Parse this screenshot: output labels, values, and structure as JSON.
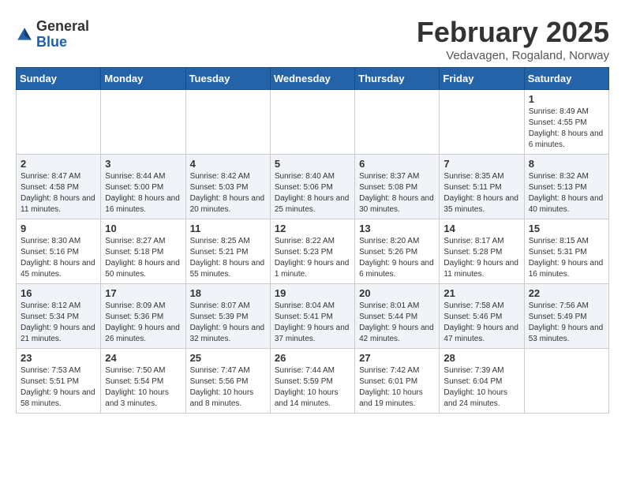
{
  "logo": {
    "general": "General",
    "blue": "Blue"
  },
  "header": {
    "title": "February 2025",
    "subtitle": "Vedavagen, Rogaland, Norway"
  },
  "weekdays": [
    "Sunday",
    "Monday",
    "Tuesday",
    "Wednesday",
    "Thursday",
    "Friday",
    "Saturday"
  ],
  "weeks": [
    [
      {
        "day": "",
        "info": ""
      },
      {
        "day": "",
        "info": ""
      },
      {
        "day": "",
        "info": ""
      },
      {
        "day": "",
        "info": ""
      },
      {
        "day": "",
        "info": ""
      },
      {
        "day": "",
        "info": ""
      },
      {
        "day": "1",
        "info": "Sunrise: 8:49 AM\nSunset: 4:55 PM\nDaylight: 8 hours and 6 minutes."
      }
    ],
    [
      {
        "day": "2",
        "info": "Sunrise: 8:47 AM\nSunset: 4:58 PM\nDaylight: 8 hours and 11 minutes."
      },
      {
        "day": "3",
        "info": "Sunrise: 8:44 AM\nSunset: 5:00 PM\nDaylight: 8 hours and 16 minutes."
      },
      {
        "day": "4",
        "info": "Sunrise: 8:42 AM\nSunset: 5:03 PM\nDaylight: 8 hours and 20 minutes."
      },
      {
        "day": "5",
        "info": "Sunrise: 8:40 AM\nSunset: 5:06 PM\nDaylight: 8 hours and 25 minutes."
      },
      {
        "day": "6",
        "info": "Sunrise: 8:37 AM\nSunset: 5:08 PM\nDaylight: 8 hours and 30 minutes."
      },
      {
        "day": "7",
        "info": "Sunrise: 8:35 AM\nSunset: 5:11 PM\nDaylight: 8 hours and 35 minutes."
      },
      {
        "day": "8",
        "info": "Sunrise: 8:32 AM\nSunset: 5:13 PM\nDaylight: 8 hours and 40 minutes."
      }
    ],
    [
      {
        "day": "9",
        "info": "Sunrise: 8:30 AM\nSunset: 5:16 PM\nDaylight: 8 hours and 45 minutes."
      },
      {
        "day": "10",
        "info": "Sunrise: 8:27 AM\nSunset: 5:18 PM\nDaylight: 8 hours and 50 minutes."
      },
      {
        "day": "11",
        "info": "Sunrise: 8:25 AM\nSunset: 5:21 PM\nDaylight: 8 hours and 55 minutes."
      },
      {
        "day": "12",
        "info": "Sunrise: 8:22 AM\nSunset: 5:23 PM\nDaylight: 9 hours and 1 minute."
      },
      {
        "day": "13",
        "info": "Sunrise: 8:20 AM\nSunset: 5:26 PM\nDaylight: 9 hours and 6 minutes."
      },
      {
        "day": "14",
        "info": "Sunrise: 8:17 AM\nSunset: 5:28 PM\nDaylight: 9 hours and 11 minutes."
      },
      {
        "day": "15",
        "info": "Sunrise: 8:15 AM\nSunset: 5:31 PM\nDaylight: 9 hours and 16 minutes."
      }
    ],
    [
      {
        "day": "16",
        "info": "Sunrise: 8:12 AM\nSunset: 5:34 PM\nDaylight: 9 hours and 21 minutes."
      },
      {
        "day": "17",
        "info": "Sunrise: 8:09 AM\nSunset: 5:36 PM\nDaylight: 9 hours and 26 minutes."
      },
      {
        "day": "18",
        "info": "Sunrise: 8:07 AM\nSunset: 5:39 PM\nDaylight: 9 hours and 32 minutes."
      },
      {
        "day": "19",
        "info": "Sunrise: 8:04 AM\nSunset: 5:41 PM\nDaylight: 9 hours and 37 minutes."
      },
      {
        "day": "20",
        "info": "Sunrise: 8:01 AM\nSunset: 5:44 PM\nDaylight: 9 hours and 42 minutes."
      },
      {
        "day": "21",
        "info": "Sunrise: 7:58 AM\nSunset: 5:46 PM\nDaylight: 9 hours and 47 minutes."
      },
      {
        "day": "22",
        "info": "Sunrise: 7:56 AM\nSunset: 5:49 PM\nDaylight: 9 hours and 53 minutes."
      }
    ],
    [
      {
        "day": "23",
        "info": "Sunrise: 7:53 AM\nSunset: 5:51 PM\nDaylight: 9 hours and 58 minutes."
      },
      {
        "day": "24",
        "info": "Sunrise: 7:50 AM\nSunset: 5:54 PM\nDaylight: 10 hours and 3 minutes."
      },
      {
        "day": "25",
        "info": "Sunrise: 7:47 AM\nSunset: 5:56 PM\nDaylight: 10 hours and 8 minutes."
      },
      {
        "day": "26",
        "info": "Sunrise: 7:44 AM\nSunset: 5:59 PM\nDaylight: 10 hours and 14 minutes."
      },
      {
        "day": "27",
        "info": "Sunrise: 7:42 AM\nSunset: 6:01 PM\nDaylight: 10 hours and 19 minutes."
      },
      {
        "day": "28",
        "info": "Sunrise: 7:39 AM\nSunset: 6:04 PM\nDaylight: 10 hours and 24 minutes."
      },
      {
        "day": "",
        "info": ""
      }
    ]
  ]
}
